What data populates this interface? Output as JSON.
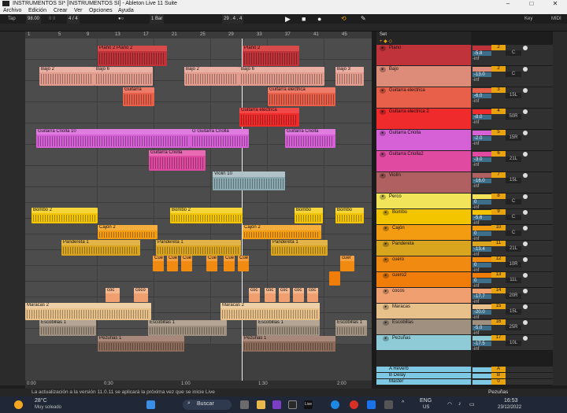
{
  "window": {
    "title": "INSTRUMENTOS SI* [INSTRUMENTOS SI] - Ableton Live 11 Suite"
  },
  "menu": [
    "Archivo",
    "Edición",
    "Crear",
    "Ver",
    "Opciones",
    "Ayuda"
  ],
  "transport": {
    "tap": "Tap",
    "tempo": "98.00",
    "signature": "4 / 4",
    "quantize": "1 Bar",
    "position": "29 .  4 .  4",
    "key": "Key",
    "midi": "MIDI"
  },
  "ruler": [
    "1",
    "5",
    "9",
    "13",
    "17",
    "21",
    "25",
    "29",
    "33",
    "37",
    "41",
    "45"
  ],
  "bottom_ruler": [
    "0:00",
    "0:30",
    "1:00",
    "1:30",
    "2:00"
  ],
  "set_label": "Set",
  "tracks": [
    {
      "name": "Piano",
      "color": "#c0333a",
      "num": "2",
      "vol": "-5.8",
      "pan": "C"
    },
    {
      "name": "Bajo",
      "color": "#dd8c7a",
      "num": "2",
      "vol": "-13.0",
      "pan": "C"
    },
    {
      "name": "Guitarra electrica",
      "color": "#e8604a",
      "num": "3",
      "vol": "-6.0",
      "pan": "15L"
    },
    {
      "name": "Guitarra electrica 2",
      "color": "#ef2b2b",
      "num": "4",
      "vol": "-8.0",
      "pan": "50R"
    },
    {
      "name": "Guitarra Criolla",
      "color": "#d661d6",
      "num": "5",
      "vol": "-2.0",
      "pan": "15R"
    },
    {
      "name": "Guitarra Criolla2",
      "color": "#e04aa0",
      "num": "6",
      "vol": "-3.0",
      "pan": "21L"
    },
    {
      "name": "Violín",
      "color": "#b06060",
      "num": "7",
      "vol": "-16.0",
      "pan": "15L"
    },
    {
      "name": "Perco",
      "color": "#f1e45a",
      "num": "8",
      "vol": "0",
      "pan": "C"
    },
    {
      "name": "Bombo",
      "color": "#f2c500",
      "num": "9",
      "vol": "-5.6",
      "pan": "C"
    },
    {
      "name": "Cajón",
      "color": "#f39c12",
      "num": "10",
      "vol": "0",
      "pan": "C"
    },
    {
      "name": "Pandereta",
      "color": "#d9a41e",
      "num": "11",
      "vol": "-13.4",
      "pan": "21L"
    },
    {
      "name": "cuero",
      "color": "#f08a10",
      "num": "12",
      "vol": "0",
      "pan": "10R"
    },
    {
      "name": "cuero2",
      "color": "#f07d0a",
      "num": "13",
      "vol": "0",
      "pan": "11L"
    },
    {
      "name": "cocos",
      "color": "#f0a070",
      "num": "14",
      "vol": "-17.7",
      "pan": "20R"
    },
    {
      "name": "Maracas",
      "color": "#e8c08a",
      "num": "15",
      "vol": "-20.0",
      "pan": "15L"
    },
    {
      "name": "Escobillas",
      "color": "#a09080",
      "num": "16",
      "vol": "-5.0",
      "pan": "25R"
    },
    {
      "name": "Pezuñas",
      "color": "#8ecbd6",
      "num": "17",
      "vol": "-17.5",
      "pan": "10L"
    }
  ],
  "returns": [
    {
      "name": "A Reverb",
      "color": "#7ec8e3",
      "num": "A"
    },
    {
      "name": "B Delay",
      "color": "#7ec8e3",
      "num": "B"
    },
    {
      "name": "Master",
      "color": "#7ec8e3",
      "num": "0"
    }
  ],
  "clips": {
    "piano": [
      "Piano 2 Piano 2",
      "Piano 2"
    ],
    "bajo": [
      "Bajo 2",
      "Bajo 6",
      "Bajo 2",
      "Bajo 6",
      "Bajo 3"
    ],
    "guitarra": [
      "Guitarra",
      "Guitarra electrica"
    ],
    "guitarra2": [
      "Guitarra electrica"
    ],
    "criolla": [
      "Guitarra Criolla 10",
      "G Guitarra Criolla",
      "Guitarra Criolla"
    ],
    "criolla2": [
      "Guitarra Criolla"
    ],
    "violin": [
      "Violin 10"
    ],
    "bombo": [
      "Bombo 2",
      "Bombo 2",
      "Bombo",
      "Bombo"
    ],
    "cajon": [
      "Cajón 2",
      "Cajón 2"
    ],
    "pandereta": [
      "Pandereta 1",
      "Pandereta 1",
      "Pandereta 1"
    ],
    "cuero": [
      "Cue",
      "Cue",
      "Cue",
      "Cue",
      "Cue",
      "Cue",
      "cuer"
    ],
    "cocos": [
      "coc",
      "coco",
      "coc",
      "coc",
      "coc",
      "coc",
      "coc"
    ],
    "maracas": [
      "Maracas 2",
      "Maracas 2"
    ],
    "escobillas": [
      "Escobillas 1",
      "Escobillas 1",
      "Escobillas 1",
      "Escobillas 1"
    ],
    "pezunas": [
      "Pezuñas 1",
      "Pezuñas 1"
    ]
  },
  "status": {
    "message": "La actualización a la versión 11.0.11 se aplicará la próxima vez que se inicie Live",
    "selected": "Pezuñas"
  },
  "taskbar": {
    "weather_temp": "28°C",
    "weather_desc": "Muy soleado",
    "search": "Buscar",
    "lang": "ENG",
    "region": "US",
    "time": "16:53",
    "date": "23/12/2022"
  },
  "mix_inf": "-inf"
}
